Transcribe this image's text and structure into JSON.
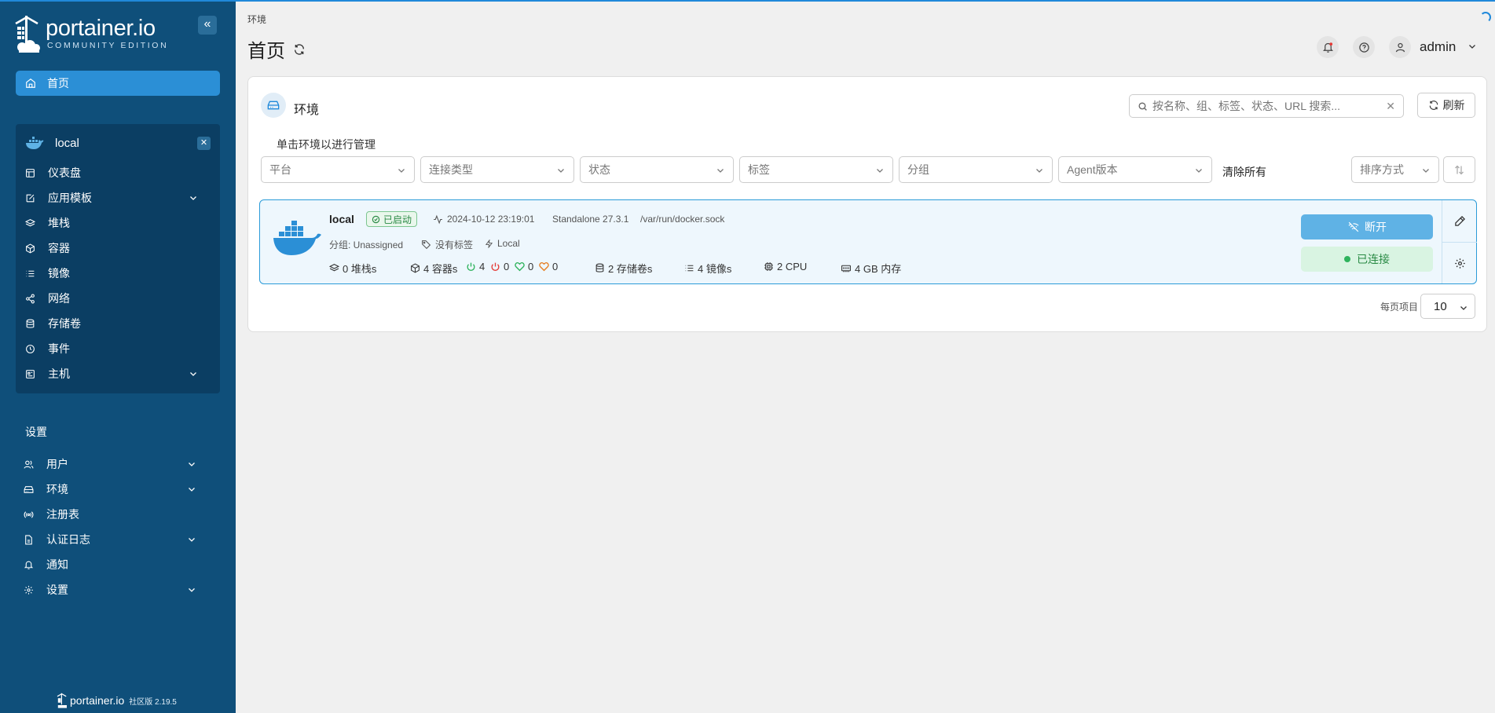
{
  "app": {
    "logo_name": "portainer.io",
    "logo_edition": "COMMUNITY EDITION",
    "footer_name": "portainer.io",
    "footer_version": "社区版 2.19.5"
  },
  "sidebar": {
    "home": "首页",
    "environment": "local",
    "env_items": [
      {
        "label": "仪表盘"
      },
      {
        "label": "应用模板"
      },
      {
        "label": "堆栈"
      },
      {
        "label": "容器"
      },
      {
        "label": "镜像"
      },
      {
        "label": "网络"
      },
      {
        "label": "存储卷"
      },
      {
        "label": "事件"
      },
      {
        "label": "主机"
      }
    ],
    "settings_title": "设置",
    "settings_items": [
      {
        "label": "用户"
      },
      {
        "label": "环境"
      },
      {
        "label": "注册表"
      },
      {
        "label": "认证日志"
      },
      {
        "label": "通知"
      },
      {
        "label": "设置"
      }
    ]
  },
  "header": {
    "breadcrumb": "环境",
    "title": "首页",
    "user": "admin"
  },
  "panel": {
    "title": "环境",
    "search_placeholder": "按名称、组、标签、状态、URL 搜索...",
    "refresh": "刷新",
    "hint": "单击环境以进行管理",
    "filters": [
      "平台",
      "连接类型",
      "状态",
      "标签",
      "分组",
      "Agent版本"
    ],
    "clear_all": "清除所有",
    "sort_by": "排序方式",
    "per_page_label": "每页项目",
    "per_page_value": "10"
  },
  "environment_card": {
    "name": "local",
    "status": "已启动",
    "heartbeat": "2024-10-12 23:19:01",
    "type": "Standalone 27.3.1",
    "url": "/var/run/docker.sock",
    "group": "分组: Unassigned",
    "tags": "没有标签",
    "connection": "Local",
    "stacks": "0 堆栈s",
    "containers": "4 容器s",
    "running": "4",
    "stopped": "0",
    "healthy": "0",
    "unhealthy": "0",
    "volumes": "2 存储卷s",
    "images": "4 镜像s",
    "cpu": "2 CPU",
    "memory": "4 GB 内存",
    "disconnect": "断开",
    "connected": "已连接"
  },
  "colors": {
    "sidebar_bg": "#0f4f7a",
    "sidebar_active": "#2b8fd6",
    "accent": "#2089da",
    "success": "#2fb35d"
  }
}
